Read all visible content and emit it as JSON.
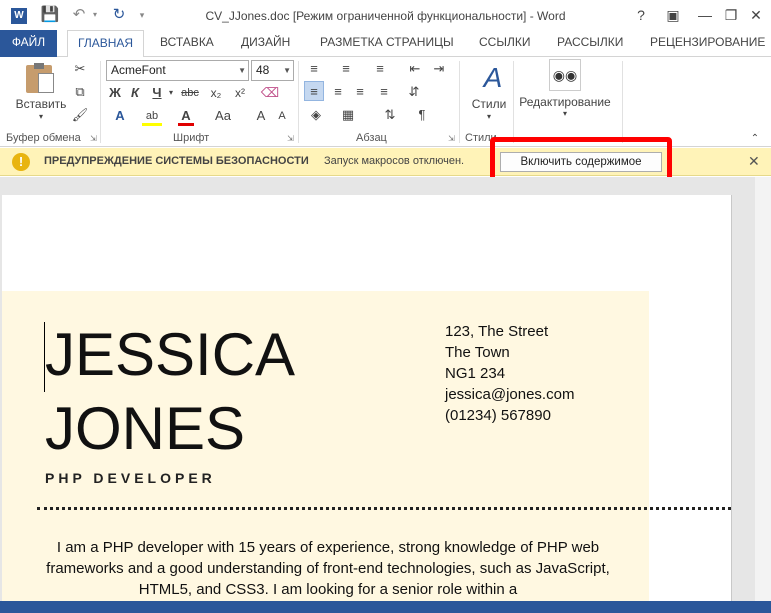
{
  "window": {
    "title": "CV_JJones.doc [Режим ограниченной функциональности] - Word",
    "app_icon_letter": "W",
    "help_label": "?"
  },
  "tabs": {
    "file": "ФАЙЛ",
    "items": [
      "ГЛАВНАЯ",
      "ВСТАВКА",
      "ДИЗАЙН",
      "РАЗМЕТКА СТРАНИЦЫ",
      "ССЫЛКИ",
      "РАССЫЛКИ",
      "РЕЦЕНЗИРОВАНИЕ"
    ]
  },
  "ribbon": {
    "paste_label": "Вставить",
    "font_name": "AcmeFont",
    "font_size": "48",
    "styles_label": "Стили",
    "editing_label": "Редактирование",
    "groups": {
      "clipboard": "Буфер обмена",
      "font": "Шрифт",
      "paragraph": "Абзац",
      "styles": "Стили"
    },
    "format_buttons": {
      "bold": "Ж",
      "italic": "К",
      "underline": "Ч",
      "strike": "abc",
      "subscript": "x₂",
      "superscript": "x²"
    }
  },
  "security_bar": {
    "title": "ПРЕДУПРЕЖДЕНИЕ СИСТЕМЫ БЕЗОПАСНОСТИ",
    "message": "Запуск макросов отключен.",
    "button": "Включить содержимое",
    "highlight_color": "#ff0000"
  },
  "document": {
    "name_line1": "JESSICA",
    "name_line2": "JONES",
    "role": "PHP DEVELOPER",
    "address": [
      "123, The Street",
      "The Town",
      "NG1 234",
      "jessica@jones.com",
      "(01234) 567890"
    ],
    "bio": "I am a PHP developer with 15 years of experience, strong knowledge of PHP web frameworks and a good understanding of front-end technologies, such as JavaScript, HTML5, and CSS3. I am looking for a senior role within a"
  },
  "colors": {
    "brand": "#2b579a",
    "cv_background": "#fff8e1",
    "security_bar": "#fff3b8"
  }
}
